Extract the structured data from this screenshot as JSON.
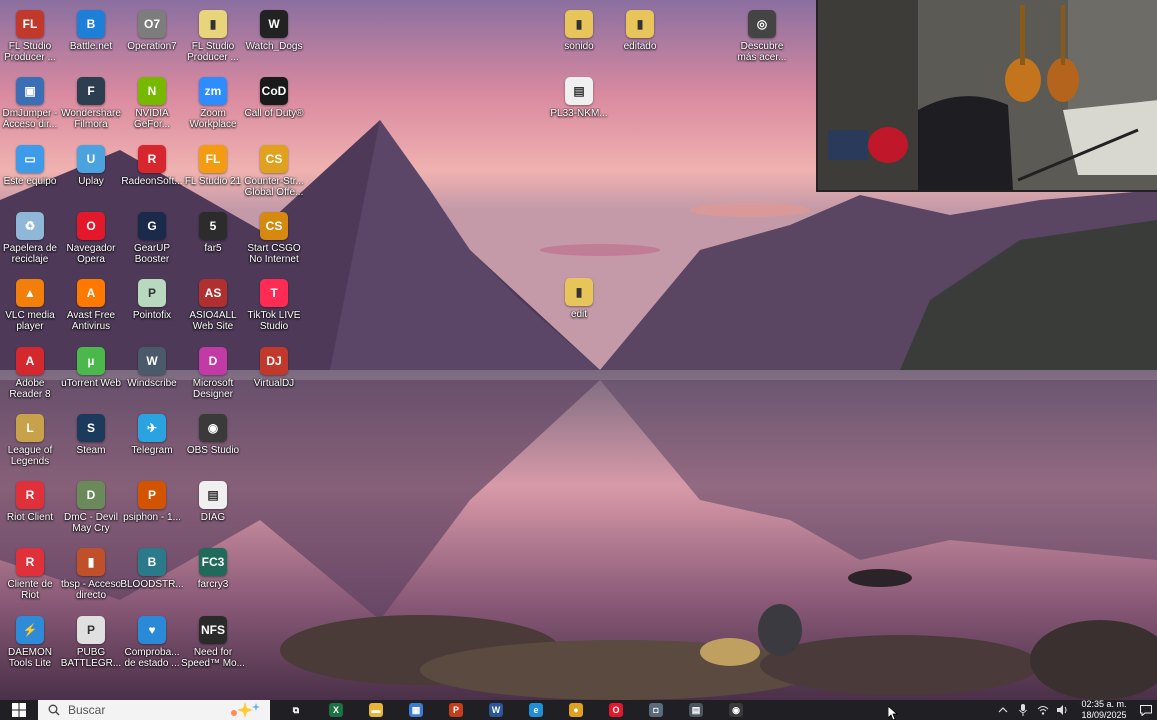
{
  "desktop": {
    "icons": [
      {
        "label": "FL Studio Producer ...",
        "color": "#c0392b",
        "glyph": "FL"
      },
      {
        "label": "Battle.net",
        "color": "#1e7fd8",
        "glyph": "B"
      },
      {
        "label": "Operation7",
        "color": "#7d7d7d",
        "glyph": "O7"
      },
      {
        "label": "FL Studio Producer ...",
        "color": "#e8d47a",
        "glyph": "▮"
      },
      {
        "label": "Watch_Dogs",
        "color": "#222222",
        "glyph": "W"
      },
      {
        "label": "DmJumper - Acceso dir...",
        "color": "#3a6fb5",
        "glyph": "▣"
      },
      {
        "label": "Wondershare Filmora",
        "color": "#2c3e50",
        "glyph": "F"
      },
      {
        "label": "NVIDIA GeFor...",
        "color": "#76b900",
        "glyph": "N"
      },
      {
        "label": "Zoom Workplace",
        "color": "#2d8cff",
        "glyph": "zm"
      },
      {
        "label": "Call of Duty®",
        "color": "#1a1a1a",
        "glyph": "CoD"
      },
      {
        "label": "Este equipo",
        "color": "#3d9be9",
        "glyph": "▭"
      },
      {
        "label": "Uplay",
        "color": "#4aa3df",
        "glyph": "U"
      },
      {
        "label": "RadeonSoft...",
        "color": "#d7262e",
        "glyph": "R"
      },
      {
        "label": "FL Studio 21",
        "color": "#f39c12",
        "glyph": "FL"
      },
      {
        "label": "Counter-Str... Global Offe...",
        "color": "#e0a21e",
        "glyph": "CS"
      },
      {
        "label": "Papelera de reciclaje",
        "color": "#8fb8d8",
        "glyph": "♻"
      },
      {
        "label": "Navegador Opera",
        "color": "#e3192b",
        "glyph": "O"
      },
      {
        "label": "GearUP Booster",
        "color": "#1b2a4a",
        "glyph": "G"
      },
      {
        "label": "far5",
        "color": "#2c2c2c",
        "glyph": "5"
      },
      {
        "label": "Start CSGO No Internet",
        "color": "#d68910",
        "glyph": "CS"
      },
      {
        "label": "VLC media player",
        "color": "#f27f0c",
        "glyph": "▲"
      },
      {
        "label": "Avast Free Antivirus",
        "color": "#ff7800",
        "glyph": "A"
      },
      {
        "label": "Pointofix",
        "color": "#b8d8c0",
        "glyph": "P"
      },
      {
        "label": "ASIO4ALL Web Site",
        "color": "#b03030",
        "glyph": "AS"
      },
      {
        "label": "TikTok LIVE Studio",
        "color": "#fe2c55",
        "glyph": "T"
      },
      {
        "label": "Adobe Reader 8",
        "color": "#d4282e",
        "glyph": "A"
      },
      {
        "label": "uTorrent Web",
        "color": "#4ab84a",
        "glyph": "µ"
      },
      {
        "label": "Windscribe",
        "color": "#4a5a6a",
        "glyph": "W"
      },
      {
        "label": "Microsoft Designer",
        "color": "#c23aa6",
        "glyph": "D"
      },
      {
        "label": "VirtualDJ",
        "color": "#c0392b",
        "glyph": "DJ"
      },
      {
        "label": "League of Legends",
        "color": "#c8a24a",
        "glyph": "L"
      },
      {
        "label": "Steam",
        "color": "#1b3a5c",
        "glyph": "S"
      },
      {
        "label": "Telegram",
        "color": "#2aa3e0",
        "glyph": "✈"
      },
      {
        "label": "OBS Studio",
        "color": "#3a3a3a",
        "glyph": "◉"
      },
      {
        "label": "Riot Client",
        "color": "#e0303a",
        "glyph": "R"
      },
      {
        "label": "DmC - Devil May Cry",
        "color": "#6a8a5a",
        "glyph": "D"
      },
      {
        "label": "psiphon - 1...",
        "color": "#d35400",
        "glyph": "P"
      },
      {
        "label": "DIAG",
        "color": "#f0f0f0",
        "glyph": "▤"
      },
      {
        "label": "Cliente de Riot",
        "color": "#e0303a",
        "glyph": "R"
      },
      {
        "label": "tbsp - Acceso directo",
        "color": "#c0502a",
        "glyph": "▮"
      },
      {
        "label": "BLOODSTR...",
        "color": "#2a7a8a",
        "glyph": "B"
      },
      {
        "label": "farcry3",
        "color": "#1f6a5a",
        "glyph": "FC3"
      },
      {
        "label": "DAEMON Tools Lite",
        "color": "#2e8bd8",
        "glyph": "⚡"
      },
      {
        "label": "PUBG BATTLEGR...",
        "color": "#e0e0e0",
        "glyph": "P"
      },
      {
        "label": "Comproba... de estado ...",
        "color": "#2a8ad8",
        "glyph": "♥"
      },
      {
        "label": "Need for Speed™ Mo...",
        "color": "#2a2a2a",
        "glyph": "NFS"
      },
      {
        "label": "sonido",
        "color": "#e8c55a",
        "glyph": "▮"
      },
      {
        "label": "editado",
        "color": "#e8c55a",
        "glyph": "▮"
      },
      {
        "label": "Descubre más acer...",
        "color": "#444444",
        "glyph": "◎"
      },
      {
        "label": "PL33-NKM...",
        "color": "#f0f0f0",
        "glyph": "▤"
      },
      {
        "label": "edit",
        "color": "#e8c55a",
        "glyph": "▮"
      }
    ]
  },
  "taskbar": {
    "search_placeholder": "Buscar",
    "apps": [
      {
        "name": "task-view",
        "color": "#1f1f24",
        "glyph": "⧉"
      },
      {
        "name": "excel",
        "color": "#1d7044",
        "glyph": "X"
      },
      {
        "name": "file-explorer",
        "color": "#e8b53a",
        "glyph": "▬"
      },
      {
        "name": "store",
        "color": "#3a7bd5",
        "glyph": "▦"
      },
      {
        "name": "powerpoint",
        "color": "#c43e1c",
        "glyph": "P"
      },
      {
        "name": "word",
        "color": "#2b579a",
        "glyph": "W"
      },
      {
        "name": "edge",
        "color": "#1f8fd8",
        "glyph": "e"
      },
      {
        "name": "chrome",
        "color": "#e0a020",
        "glyph": "●"
      },
      {
        "name": "opera",
        "color": "#e3192b",
        "glyph": "O"
      },
      {
        "name": "camera",
        "color": "#5a6a7a",
        "glyph": "◘"
      },
      {
        "name": "calculator",
        "color": "#4a5560",
        "glyph": "▤"
      },
      {
        "name": "obs",
        "color": "#3a3a3a",
        "glyph": "◉"
      }
    ],
    "clock_time": "02:35 a. m.",
    "clock_date": "18/09/2025"
  }
}
